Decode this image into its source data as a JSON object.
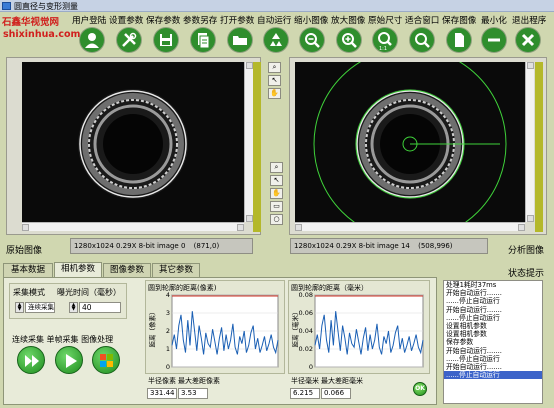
{
  "window": {
    "title": "圆直径与变形测量"
  },
  "brand": {
    "line1": "石鑫华视觉网",
    "line2": "shixinhua.com"
  },
  "menu": [
    "用户登陆",
    "设置参数",
    "保存参数",
    "参数另存",
    "打开参数",
    "自动运行",
    "缩小图像",
    "放大图像",
    "原始尺寸",
    "适合窗口",
    "保存图像",
    "最小化",
    "退出程序"
  ],
  "toolbar_icons": [
    "user-login-icon",
    "settings-tools-icon",
    "save-icon",
    "save-as-icon",
    "open-folder-icon",
    "recycle-icon",
    "zoom-out-icon",
    "zoom-in-icon",
    "zoom-1to1-icon",
    "zoom-fit-icon",
    "save-image-icon",
    "minimize-icon",
    "close-icon"
  ],
  "left_view": {
    "label": "原始图像",
    "info": "1280x1024 0.29X 8-bit image 0",
    "coords": "(871,0)"
  },
  "right_view": {
    "label": "分析图像",
    "info": "1280x1024 0.29X 8-bit image 14",
    "coords": "(508,996)"
  },
  "tabs": [
    "基本数据",
    "相机参数",
    "图像参数",
    "其它参数"
  ],
  "active_tab": 1,
  "status_title": "状态提示",
  "camera": {
    "capture_mode_label": "采集模式",
    "capture_mode_value": "连续采集",
    "exposure_label": "曝光时间（毫秒）",
    "exposure_value": "40",
    "action_labels": "连续采集 单帧采集 图像处理"
  },
  "chart_pixel": {
    "title": "圆到轮廓的距离(像素)",
    "ylabel": "距离（像素）",
    "radius_label": "半径像素",
    "max_dist_label": "最大差距像素",
    "radius_value": "331.44",
    "max_dist_value": "3.53"
  },
  "chart_mm": {
    "title": "圆到轮廓的距离（毫米）",
    "ylabel": "距离（毫米）",
    "radius_label": "半径毫米",
    "max_dist_label": "最大差距毫米",
    "radius_value": "6.215",
    "max_dist_value": "0.066"
  },
  "ok_label": "OK",
  "status_log": [
    "处理1耗时37ms",
    "开始自动运行.......",
    "......停止自动运行",
    "开始自动运行.......",
    "......停止自动运行",
    "设置相机参数",
    "设置相机参数",
    "保存参数",
    "开始自动运行.......",
    "......停止自动运行",
    "开始自动运行.......",
    "......停止自动运行"
  ],
  "colors": {
    "accent_green": "#3fa33c",
    "signal_blue": "#1a5fb4",
    "limit_red": "#d03020",
    "sidebar_olive": "#b4b82a"
  },
  "chart_data": [
    {
      "type": "line",
      "title": "圆到轮廓的距离(像素)",
      "ylabel": "距离（像素）",
      "ylim": [
        0,
        4
      ],
      "yticks": [
        "4",
        "3",
        "2",
        "1",
        "0"
      ],
      "series": [
        {
          "values": [
            1.2,
            1.8,
            1.0,
            2.3,
            2.9,
            1.5,
            0.8,
            2.6,
            1.2,
            3.1,
            2.0,
            0.9,
            2.3,
            1.6,
            0.7,
            1.9,
            1.3,
            1.1,
            2.1,
            1.4,
            0.7,
            1.6,
            2.2,
            0.9,
            1.8,
            1.0,
            1.5,
            2.4,
            1.1,
            0.7,
            1.7,
            1.3,
            2.0,
            0.8,
            1.2,
            1.9,
            2.3,
            1.0,
            1.6,
            0.8,
            1.2,
            1.7,
            0.9,
            1.3,
            1.8,
            1.1,
            0.8,
            1.5
          ]
        }
      ]
    },
    {
      "type": "line",
      "title": "圆到轮廓的距离（毫米）",
      "ylabel": "距离（毫米）",
      "ylim": [
        0,
        0.08
      ],
      "yticks": [
        "0.08",
        "0.06",
        "0.04",
        "0.02",
        "0"
      ],
      "series": [
        {
          "values": [
            0.024,
            0.036,
            0.02,
            0.046,
            0.058,
            0.03,
            0.016,
            0.052,
            0.024,
            0.062,
            0.04,
            0.018,
            0.046,
            0.032,
            0.014,
            0.038,
            0.026,
            0.022,
            0.042,
            0.028,
            0.014,
            0.032,
            0.044,
            0.018,
            0.036,
            0.02,
            0.03,
            0.048,
            0.022,
            0.014,
            0.034,
            0.026,
            0.04,
            0.016,
            0.024,
            0.038,
            0.046,
            0.02,
            0.032,
            0.016,
            0.024,
            0.034,
            0.018,
            0.026,
            0.036,
            0.022,
            0.016,
            0.03
          ]
        }
      ]
    }
  ]
}
